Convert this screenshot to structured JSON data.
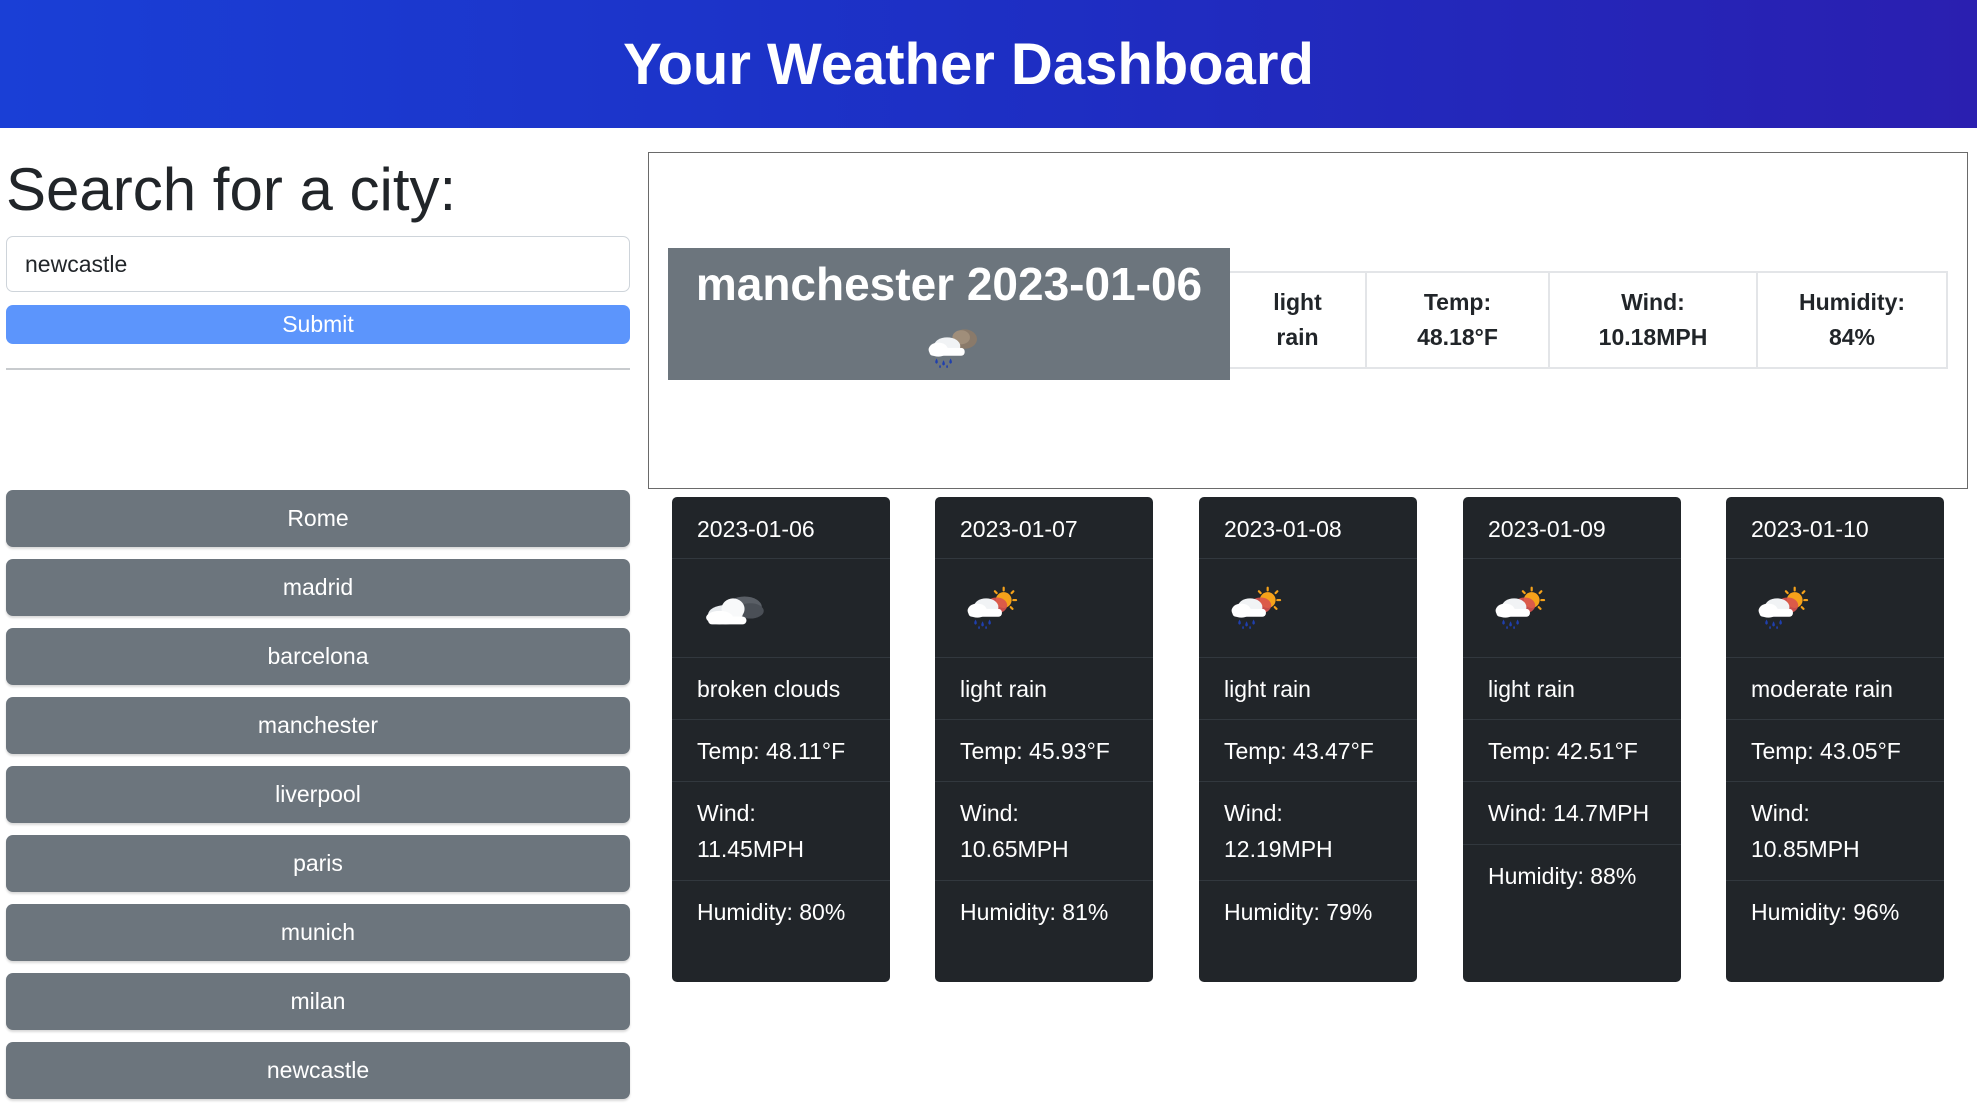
{
  "header": {
    "title": "Your Weather Dashboard"
  },
  "search": {
    "heading": "Search for a city:",
    "input_value": "newcastle",
    "submit_label": "Submit"
  },
  "history": [
    {
      "label": "Rome"
    },
    {
      "label": "madrid"
    },
    {
      "label": "barcelona"
    },
    {
      "label": "manchester"
    },
    {
      "label": "liverpool"
    },
    {
      "label": "paris"
    },
    {
      "label": "munich"
    },
    {
      "label": "milan"
    },
    {
      "label": "newcastle"
    }
  ],
  "current": {
    "title": "manchester 2023-01-06",
    "icon": "rain-cloud-night-icon",
    "description": "light rain",
    "temp_label": "Temp:",
    "temp": "48.18°F",
    "wind_label": "Wind:",
    "wind": "10.18MPH",
    "humidity_label": "Humidity:",
    "humidity": "84%"
  },
  "forecast": [
    {
      "date": "2023-01-06",
      "icon": "broken-clouds-icon",
      "description": "broken clouds",
      "temp": "Temp: 48.11°F",
      "wind": "Wind: 11.45MPH",
      "humidity": "Humidity: 80%"
    },
    {
      "date": "2023-01-07",
      "icon": "rain-sun-icon",
      "description": "light rain",
      "temp": "Temp: 45.93°F",
      "wind": "Wind: 10.65MPH",
      "humidity": "Humidity: 81%"
    },
    {
      "date": "2023-01-08",
      "icon": "rain-sun-icon",
      "description": "light rain",
      "temp": "Temp: 43.47°F",
      "wind": "Wind: 12.19MPH",
      "humidity": "Humidity: 79%"
    },
    {
      "date": "2023-01-09",
      "icon": "rain-sun-icon",
      "description": "light rain",
      "temp": "Temp: 42.51°F",
      "wind": "Wind: 14.7MPH",
      "humidity": "Humidity: 88%"
    },
    {
      "date": "2023-01-10",
      "icon": "rain-sun-icon",
      "description": "moderate rain",
      "temp": "Temp: 43.05°F",
      "wind": "Wind: 10.85MPH",
      "humidity": "Humidity: 96%"
    }
  ],
  "colors": {
    "header_gradient_start": "#1a3fd6",
    "header_gradient_end": "#2a1fb0",
    "submit": "#5c95fc",
    "history_button": "#6c757d",
    "card": "#212529"
  }
}
